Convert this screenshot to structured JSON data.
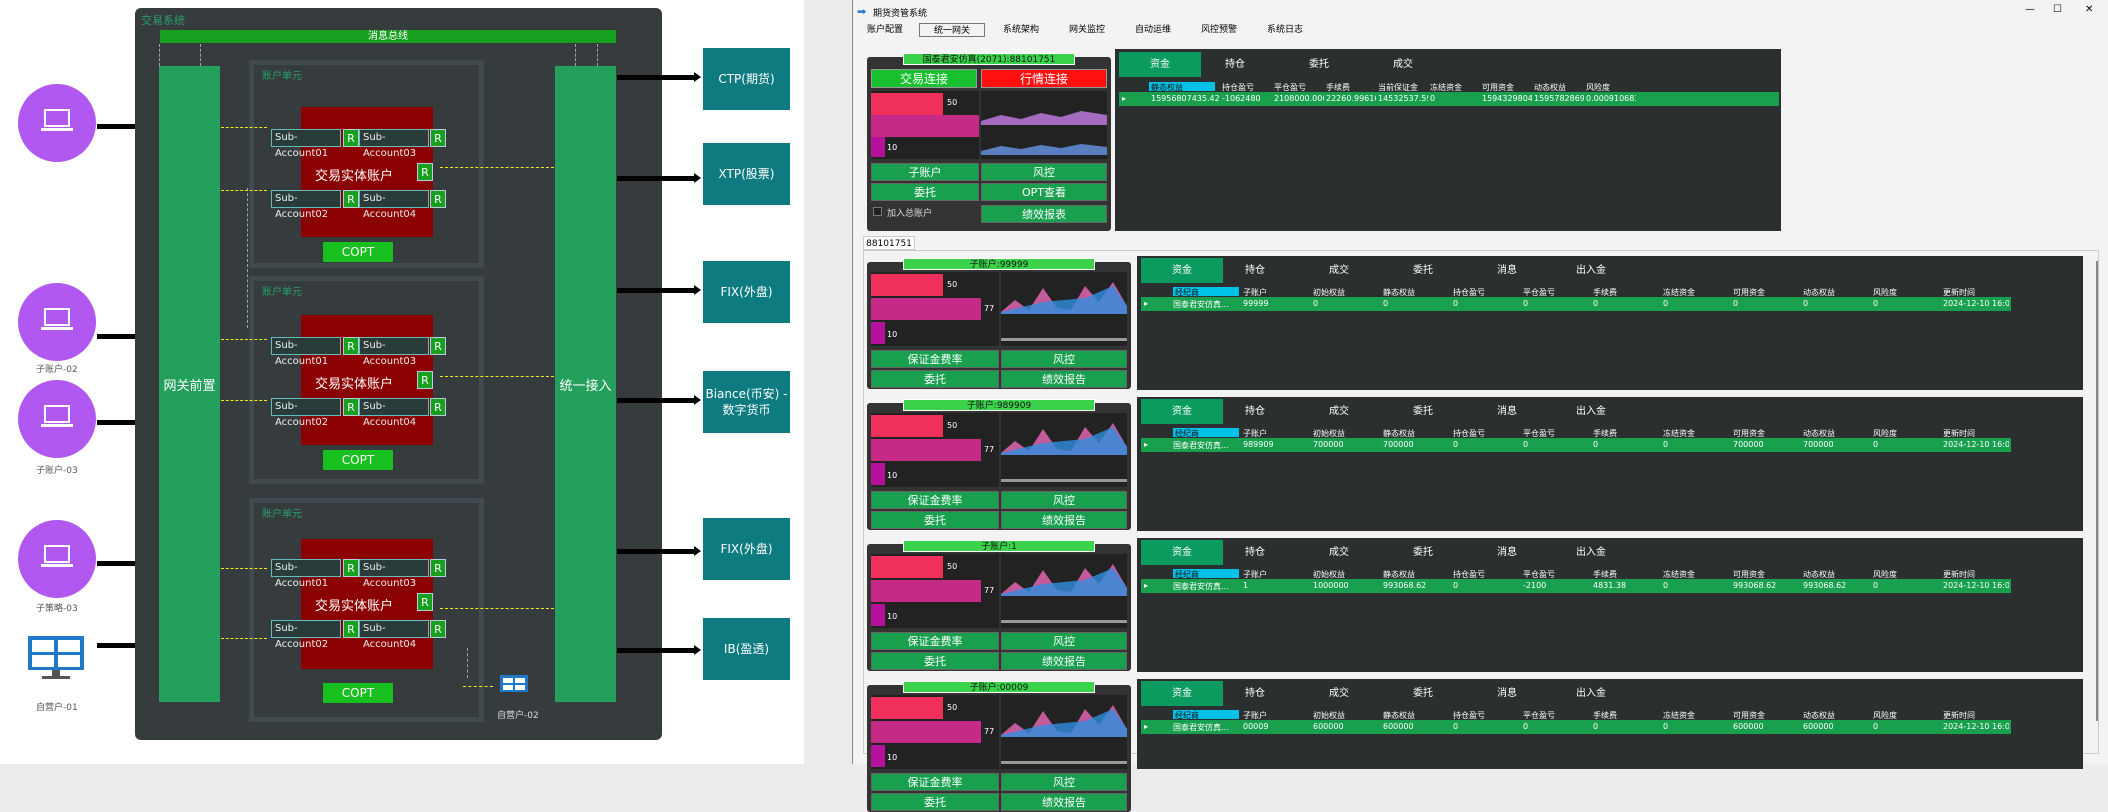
{
  "diagram": {
    "system_title": "交易系统",
    "bus_label": "消息总线",
    "gateway_front": "网关前置",
    "unified_access": "统一接入",
    "units": [
      {
        "title": "账户单元",
        "subs": [
          "Sub-Account01",
          "Sub-Account03",
          "Sub-Account02",
          "Sub-Account04"
        ],
        "entity": "交易实体账户",
        "copt": "COPT",
        "r": "R"
      },
      {
        "title": "账户单元",
        "subs": [
          "Sub-Account01",
          "Sub-Account03",
          "Sub-Account02",
          "Sub-Account04"
        ],
        "entity": "交易实体账户",
        "copt": "COPT",
        "r": "R"
      },
      {
        "title": "账户单元",
        "subs": [
          "Sub-Account01",
          "Sub-Account03",
          "Sub-Account02",
          "Sub-Account04"
        ],
        "entity": "交易实体账户",
        "copt": "COPT",
        "r": "R"
      }
    ],
    "externals": [
      "CTP(期货)",
      "XTP(股票)",
      "FIX(外盘)",
      "Biance(币安) - 数字货币",
      "FIX(外盘)",
      "IB(盈透)"
    ],
    "users": [
      "",
      "子账户-02",
      "子账户-03",
      "子策略-03"
    ],
    "admin1": "自营户-01",
    "admin2": "自营户-02"
  },
  "window": {
    "title": "期货资管系统",
    "controls": [
      "—",
      "☐",
      "✕"
    ],
    "menu": [
      "账户配置",
      "统一网关",
      "系统架构",
      "网关监控",
      "自动运维",
      "风控预警",
      "系统日志"
    ],
    "menu_active_index": 1
  },
  "top_panel": {
    "account_header": "国泰君安仿真(2071):88101751",
    "trade_conn": "交易连接",
    "market_conn": "行情连接",
    "bar_labels": [
      "50",
      "10"
    ],
    "buttons": [
      "子账户",
      "风控",
      "委托",
      "OPT查看",
      "绩效报表"
    ],
    "checkbox_label": "加入总账户",
    "tabs": [
      "资金",
      "持仓",
      "委托",
      "成交"
    ],
    "headers": [
      "静态权益",
      "持仓盈亏",
      "平仓盈亏",
      "手续费",
      "当前保证金",
      "冻结资金",
      "可用资金",
      "动态权益",
      "风险度"
    ],
    "row": [
      "15956807435.42...",
      "-1062480",
      "2108000.000000...",
      "22260.99616000...",
      "14532537.59999...",
      "0",
      "15943298045.82...",
      "15957828694.42...",
      "0.000910683901..."
    ]
  },
  "tab_label": "88101751",
  "sub_tabs": [
    "资金",
    "持仓",
    "成交",
    "委托",
    "消息",
    "出入金"
  ],
  "sub_headers": [
    "经纪商",
    "子账户",
    "初始权益",
    "静态权益",
    "持仓盈亏",
    "平仓盈亏",
    "手续费",
    "冻结资金",
    "可用资金",
    "动态权益",
    "风险度",
    "更新时间"
  ],
  "sub_buttons": [
    "保证金费率",
    "风控",
    "委托",
    "绩效报告"
  ],
  "sub_bar_labels": [
    "50",
    "77",
    "10"
  ],
  "sub_accounts": [
    {
      "header": "子账户:99999",
      "row": [
        "国泰君安仿真...",
        "99999",
        "0",
        "0",
        "0",
        "0",
        "0",
        "0",
        "0",
        "0",
        "0",
        "2024-12-10 16:0..."
      ]
    },
    {
      "header": "子账户:989909",
      "row": [
        "国泰君安仿真...",
        "989909",
        "700000",
        "700000",
        "0",
        "0",
        "0",
        "0",
        "700000",
        "700000",
        "0",
        "2024-12-10 16:0..."
      ]
    },
    {
      "header": "子账户:1",
      "row": [
        "国泰君安仿真...",
        "1",
        "1000000",
        "993068.62",
        "0",
        "-2100",
        "4831.38",
        "0",
        "993068.62",
        "993068.62",
        "0",
        "2024-12-10 16:0..."
      ]
    },
    {
      "header": "子账户:00009",
      "row": [
        "国泰君安仿真...",
        "00009",
        "600000",
        "600000",
        "0",
        "0",
        "0",
        "0",
        "600000",
        "600000",
        "0",
        "2024-12-10 16:0..."
      ]
    }
  ],
  "colors": {
    "green": "#18a04f",
    "red": "#8b0000",
    "purple": "#b158f0",
    "teal": "#0e7b80"
  }
}
